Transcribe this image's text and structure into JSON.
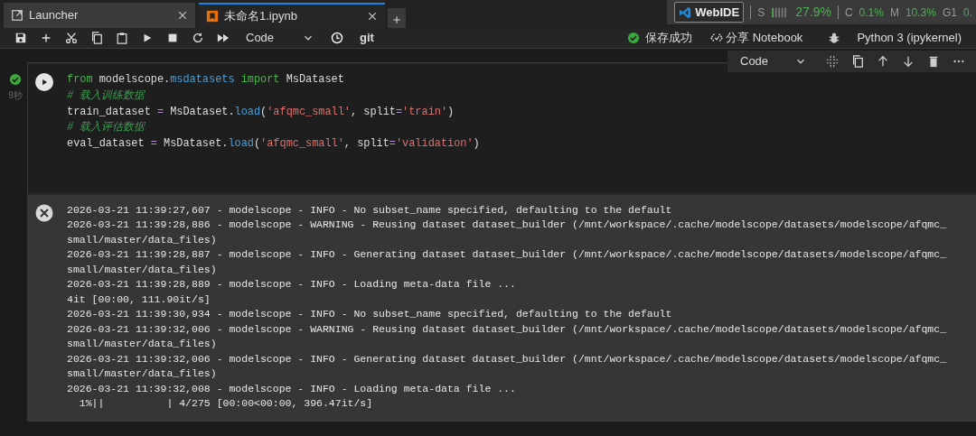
{
  "tabs": [
    {
      "label": "Launcher",
      "kind": "launcher",
      "selected": false
    },
    {
      "label": "未命名1.ipynb",
      "kind": "notebook",
      "selected": true
    }
  ],
  "status": {
    "badge": "WebIDE",
    "metrics": [
      {
        "label": "S",
        "value": "27.9%",
        "kind": "bars"
      },
      {
        "label": "C",
        "value": "0.1%",
        "kind": "plain"
      },
      {
        "label": "M",
        "value": "10.3%",
        "kind": "plain"
      },
      {
        "label": "G1",
        "value": "0.",
        "kind": "plain"
      }
    ]
  },
  "toolbar": {
    "cell_type": "Code",
    "git": "git",
    "save_status": "保存成功",
    "share": "分享 Notebook",
    "kernel": "Python 3 (ipykernel)"
  },
  "cell": {
    "succeeded": true,
    "time": "9秒",
    "cell_type": "Code",
    "code": [
      [
        {
          "kind": "keyword",
          "text": "from"
        },
        {
          "kind": "plain",
          "text": " modelscope."
        },
        {
          "kind": "module",
          "text": "msdatasets"
        },
        {
          "kind": "keyword",
          "text": " import"
        },
        {
          "kind": "plain",
          "text": " MsDataset"
        }
      ],
      [
        {
          "kind": "comment",
          "text": "# 载入训练数据"
        }
      ],
      [
        {
          "kind": "plain",
          "text": "train_dataset "
        },
        {
          "kind": "operator",
          "text": "="
        },
        {
          "kind": "plain",
          "text": " MsDataset."
        },
        {
          "kind": "function",
          "text": "load"
        },
        {
          "kind": "plain",
          "text": "("
        },
        {
          "kind": "string",
          "text": "'afqmc_small'"
        },
        {
          "kind": "plain",
          "text": ", split"
        },
        {
          "kind": "operator",
          "text": "="
        },
        {
          "kind": "string",
          "text": "'train'"
        },
        {
          "kind": "plain",
          "text": ")"
        }
      ],
      [
        {
          "kind": "comment",
          "text": "# 载入评估数据"
        }
      ],
      [
        {
          "kind": "plain",
          "text": "eval_dataset "
        },
        {
          "kind": "operator",
          "text": "="
        },
        {
          "kind": "plain",
          "text": " MsDataset."
        },
        {
          "kind": "function",
          "text": "load"
        },
        {
          "kind": "plain",
          "text": "("
        },
        {
          "kind": "string",
          "text": "'afqmc_small'"
        },
        {
          "kind": "plain",
          "text": ", split"
        },
        {
          "kind": "operator",
          "text": "="
        },
        {
          "kind": "string",
          "text": "'validation'"
        },
        {
          "kind": "plain",
          "text": ")"
        }
      ]
    ],
    "output": [
      "2026-03-21 11:39:27,607 - modelscope - INFO - No subset_name specified, defaulting to the default",
      "2026-03-21 11:39:28,886 - modelscope - WARNING - Reusing dataset dataset_builder (/mnt/workspace/.cache/modelscope/datasets/modelscope/afqmc_",
      "small/master/data_files)",
      "2026-03-21 11:39:28,887 - modelscope - INFO - Generating dataset dataset_builder (/mnt/workspace/.cache/modelscope/datasets/modelscope/afqmc_",
      "small/master/data_files)",
      "2026-03-21 11:39:28,889 - modelscope - INFO - Loading meta-data file ...",
      "4it [00:00, 111.90it/s]",
      "2026-03-21 11:39:30,934 - modelscope - INFO - No subset_name specified, defaulting to the default",
      "2026-03-21 11:39:32,006 - modelscope - WARNING - Reusing dataset dataset_builder (/mnt/workspace/.cache/modelscope/datasets/modelscope/afqmc_",
      "small/master/data_files)",
      "2026-03-21 11:39:32,006 - modelscope - INFO - Generating dataset dataset_builder (/mnt/workspace/.cache/modelscope/datasets/modelscope/afqmc_",
      "small/master/data_files)",
      "2026-03-21 11:39:32,008 - modelscope - INFO - Loading meta-data file ...",
      "  1%||          | 4/275 [00:00<00:00, 396.47it/s]"
    ]
  }
}
